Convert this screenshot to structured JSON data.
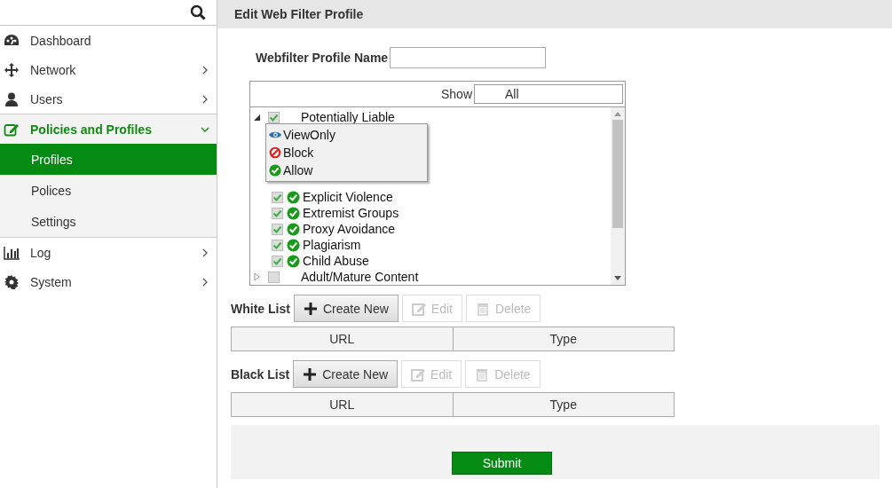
{
  "sidebar": {
    "items": [
      {
        "label": "Dashboard",
        "has_arrow": false,
        "selected": false
      },
      {
        "label": "Network",
        "has_arrow": true,
        "selected": false
      },
      {
        "label": "Users",
        "has_arrow": true,
        "selected": false
      },
      {
        "label": "Policies and Profiles",
        "has_arrow": true,
        "expanded": true,
        "selected": false,
        "children": [
          {
            "label": "Profiles",
            "selected": true
          },
          {
            "label": "Polices",
            "selected": false
          },
          {
            "label": "Settings",
            "selected": false
          }
        ]
      },
      {
        "label": "Log",
        "has_arrow": true,
        "selected": false
      },
      {
        "label": "System",
        "has_arrow": true,
        "selected": false
      }
    ]
  },
  "header": {
    "title": "Edit Web Filter Profile"
  },
  "profile_name": {
    "label": "Webfilter Profile Name"
  },
  "tree": {
    "show_label": "Show",
    "show_value": "All",
    "items": [
      {
        "label": "Potentially Liable",
        "checked": true,
        "expanded": true,
        "children": [
          {
            "label": "Explicit Violence",
            "checked": true,
            "kind": "allow"
          },
          {
            "label": "Extremist Groups",
            "checked": true,
            "kind": "allow"
          },
          {
            "label": "Proxy Avoidance",
            "checked": true,
            "kind": "allow"
          },
          {
            "label": "Plagiarism",
            "checked": true,
            "kind": "allow"
          },
          {
            "label": "Child Abuse",
            "checked": true,
            "kind": "allow"
          }
        ]
      },
      {
        "label": "Adult/Mature Content",
        "checked": false,
        "expanded": false
      }
    ],
    "menu": [
      {
        "label": "ViewOnly",
        "kind": "view"
      },
      {
        "label": "Block",
        "kind": "block"
      },
      {
        "label": "Allow",
        "kind": "allow"
      }
    ]
  },
  "lists": [
    {
      "label": "White List",
      "buttons": [
        {
          "label": "Create New",
          "kind": "create",
          "disabled": false
        },
        {
          "label": "Edit",
          "kind": "edit",
          "disabled": true
        },
        {
          "label": "Delete",
          "kind": "delete",
          "disabled": true
        }
      ],
      "columns": [
        "URL",
        "Type"
      ]
    },
    {
      "label": "Black List",
      "buttons": [
        {
          "label": "Create New",
          "kind": "create",
          "disabled": false
        },
        {
          "label": "Edit",
          "kind": "edit",
          "disabled": true
        },
        {
          "label": "Delete",
          "kind": "delete",
          "disabled": true
        }
      ],
      "columns": [
        "URL",
        "Type"
      ]
    }
  ],
  "submit": "Submit"
}
